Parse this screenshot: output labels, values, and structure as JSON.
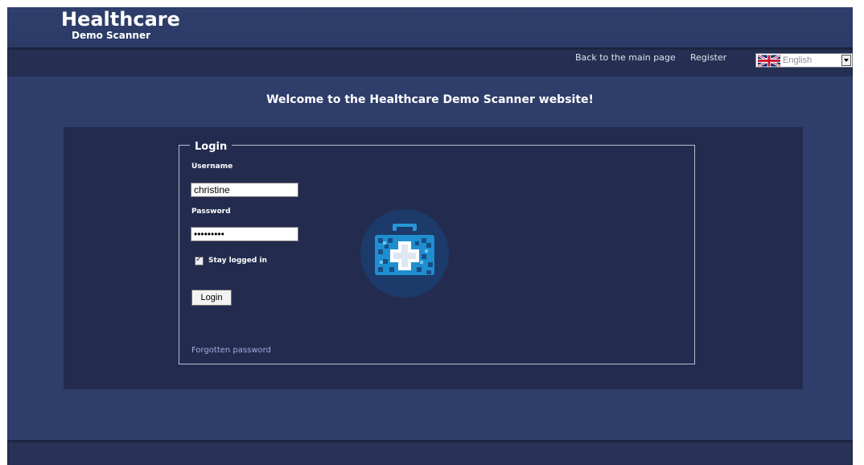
{
  "brand": {
    "title": "Healthcare",
    "subtitle": "Demo Scanner"
  },
  "nav": {
    "back_label": "Back to the main page",
    "register_label": "Register",
    "language": {
      "selected": "English",
      "flag_icon": "uk-flag-icon"
    }
  },
  "welcome_text": "Welcome to the Healthcare Demo Scanner website!",
  "login": {
    "legend": "Login",
    "username_label": "Username",
    "username_value": "christine",
    "password_label": "Password",
    "password_value": "christine",
    "stay_logged_in_label": "Stay logged in",
    "stay_logged_in_checked": true,
    "button_label": "Login",
    "forgot_label": "Forgotten password"
  },
  "colors": {
    "background": "#2e3d6a",
    "panel": "#232c4f",
    "logo_circle": "#1c3a6a",
    "logo_accent": "#1f8fcf"
  }
}
